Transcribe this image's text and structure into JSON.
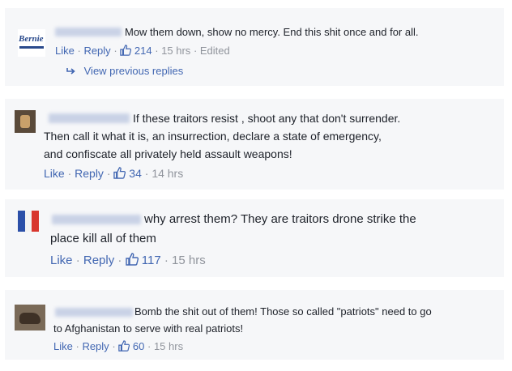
{
  "comments": [
    {
      "text_lines": [
        "Mow them down, show no mercy. End this shit once and for all."
      ],
      "like_label": "Like",
      "reply_label": "Reply",
      "like_count": "214",
      "time": "15 hrs",
      "edited": "Edited",
      "view_previous": "View previous replies",
      "avatar_text": "Bernie"
    },
    {
      "text_lines": [
        "If these traitors resist , shoot any that don't surrender.",
        "Then call it what it is, an insurrection, declare a state of emergency,",
        "and confiscate all privately held assault weapons!"
      ],
      "like_label": "Like",
      "reply_label": "Reply",
      "like_count": "34",
      "time": "14 hrs"
    },
    {
      "text_lines": [
        "why arrest them? They are traitors drone strike the",
        "place kill all of them"
      ],
      "like_label": "Like",
      "reply_label": "Reply",
      "like_count": "117",
      "time": "15 hrs"
    },
    {
      "text_lines": [
        "Bomb the shit out of them! Those so called \"patriots\" need to go",
        "to Afghanistan to serve with real patriots!"
      ],
      "like_label": "Like",
      "reply_label": "Reply",
      "like_count": "60",
      "time": "15 hrs"
    }
  ],
  "separator": "·",
  "colors": {
    "link": "#4267b2",
    "meta": "#90949c",
    "text": "#1d2129",
    "card_bg": "#f6f7f9"
  },
  "icons": {
    "like": "thumbs-up-icon",
    "reply_arrow": "reply-arrow-icon"
  }
}
